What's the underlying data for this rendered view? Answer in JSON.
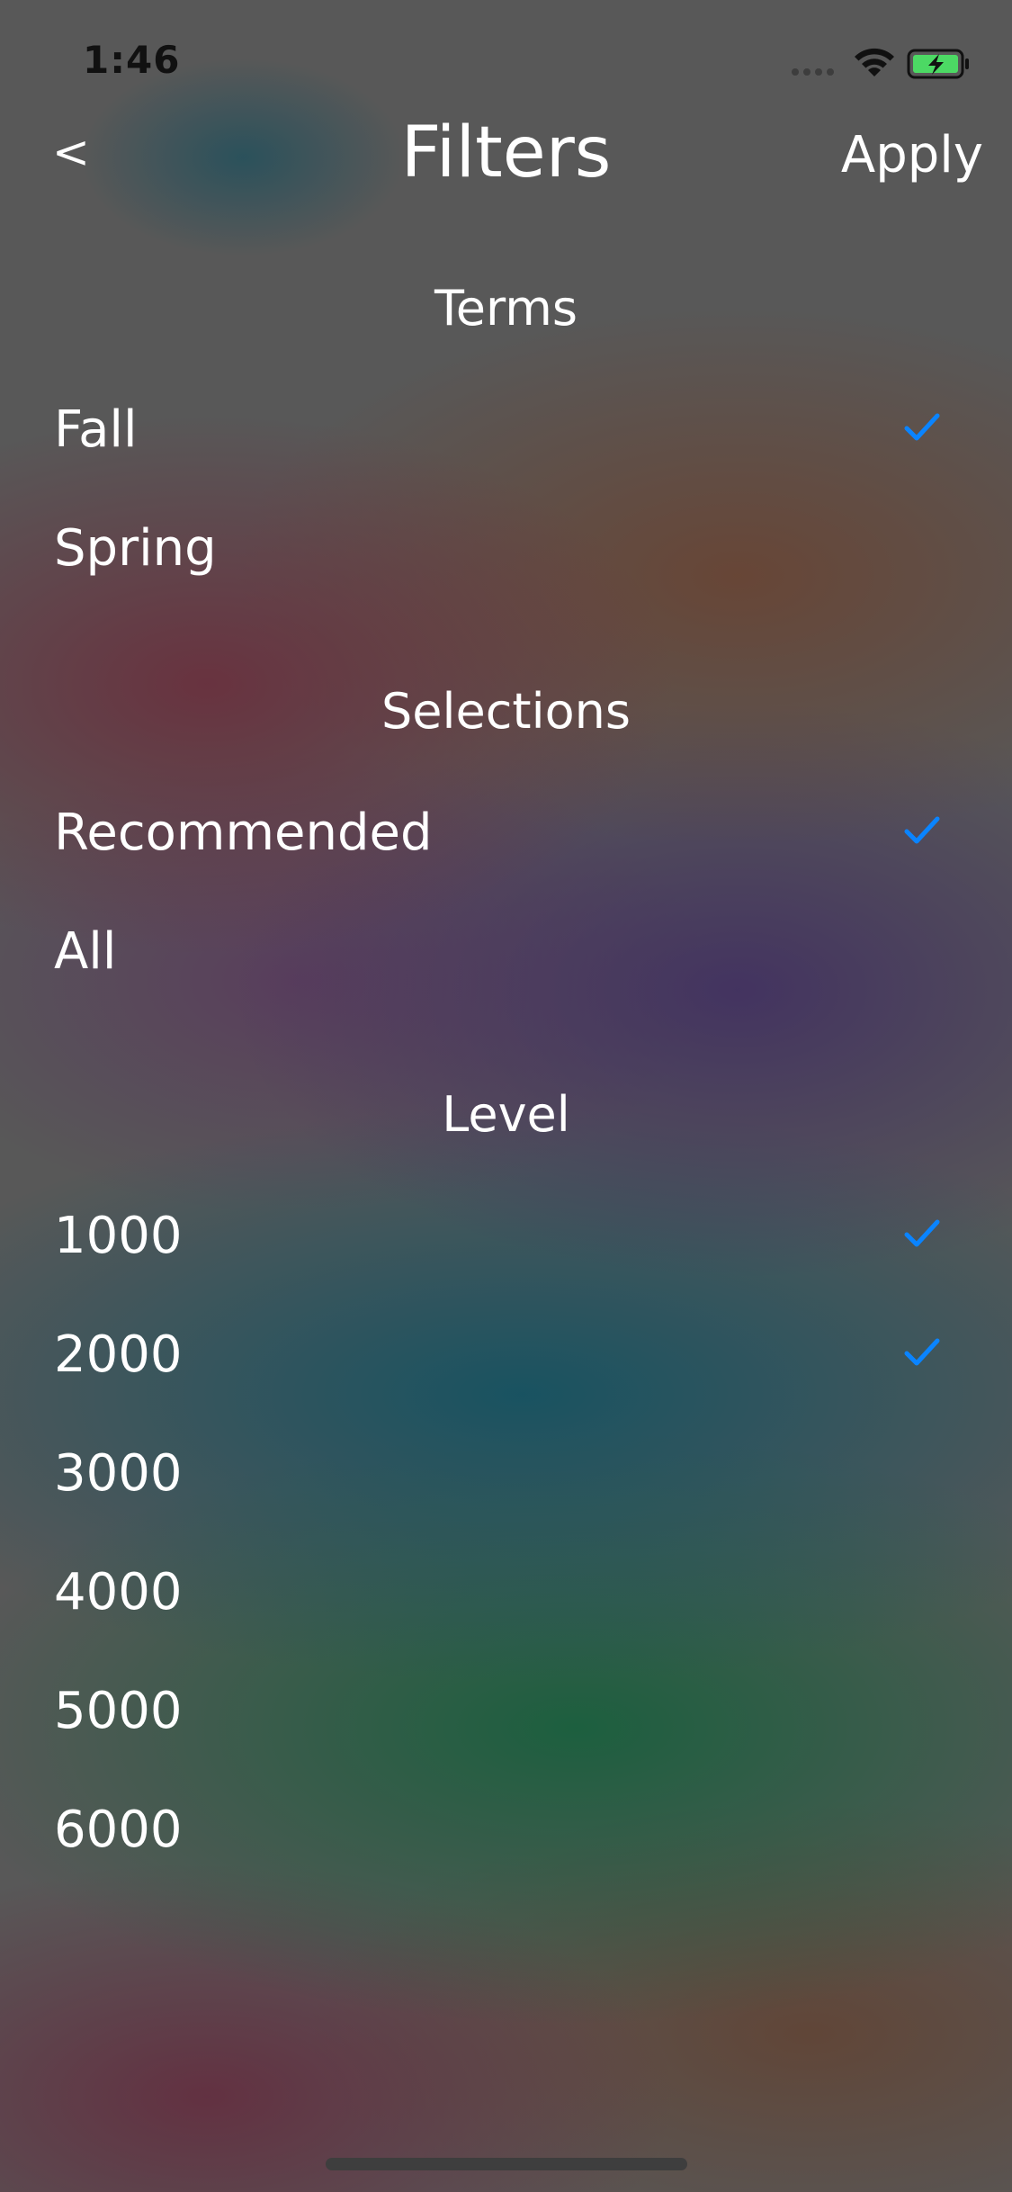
{
  "status_bar": {
    "time": "1:46",
    "icons": [
      "cellular-signal-icon",
      "wifi-icon",
      "battery-charging-icon"
    ]
  },
  "nav": {
    "back_label": "<",
    "title": "Filters",
    "apply_label": "Apply"
  },
  "colors": {
    "checkmark": "#0a84ff",
    "battery": "#4cd964"
  },
  "sections": [
    {
      "header": "Terms",
      "items": [
        {
          "label": "Fall",
          "checked": true
        },
        {
          "label": "Spring",
          "checked": false
        }
      ]
    },
    {
      "header": "Selections",
      "items": [
        {
          "label": "Recommended",
          "checked": true
        },
        {
          "label": "All",
          "checked": false
        }
      ]
    },
    {
      "header": "Level",
      "items": [
        {
          "label": "1000",
          "checked": true
        },
        {
          "label": "2000",
          "checked": true
        },
        {
          "label": "3000",
          "checked": false
        },
        {
          "label": "4000",
          "checked": false
        },
        {
          "label": "5000",
          "checked": false
        },
        {
          "label": "6000",
          "checked": false
        }
      ]
    }
  ]
}
